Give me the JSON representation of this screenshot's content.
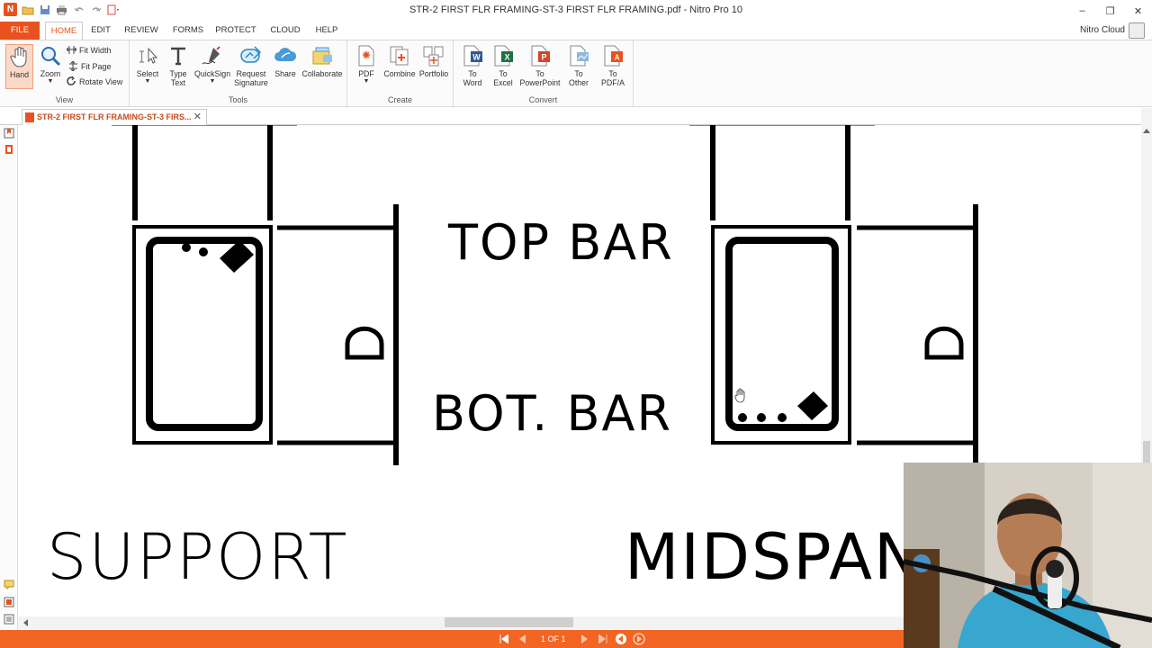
{
  "window": {
    "title": "STR-2 FIRST FLR FRAMING-ST-3 FIRST FLR FRAMING.pdf - Nitro Pro 10",
    "minimize": "–",
    "restore": "❐",
    "close": "✕"
  },
  "app_logo": "N",
  "tabs": [
    {
      "label": "FILE"
    },
    {
      "label": "HOME"
    },
    {
      "label": "EDIT"
    },
    {
      "label": "REVIEW"
    },
    {
      "label": "FORMS"
    },
    {
      "label": "PROTECT"
    },
    {
      "label": "CLOUD"
    },
    {
      "label": "HELP"
    }
  ],
  "account": {
    "label": "Nitro Cloud"
  },
  "ribbon": {
    "view": {
      "label": "View",
      "hand": "Hand",
      "zoom": "Zoom",
      "fit_width": "Fit Width",
      "fit_page": "Fit Page",
      "rotate_view": "Rotate View"
    },
    "tools": {
      "label": "Tools",
      "select": "Select",
      "type_text_1": "Type",
      "type_text_2": "Text",
      "quicksign": "QuickSign",
      "request_sig_1": "Request",
      "request_sig_2": "Signature",
      "share": "Share",
      "collaborate": "Collaborate"
    },
    "create": {
      "label": "Create",
      "pdf": "PDF",
      "combine": "Combine",
      "portfolio": "Portfolio"
    },
    "convert": {
      "label": "Convert",
      "to_word_1": "To",
      "to_word_2": "Word",
      "to_excel_1": "To",
      "to_excel_2": "Excel",
      "to_ppt_1": "To",
      "to_ppt_2": "PowerPoint",
      "to_other_1": "To",
      "to_other_2": "Other",
      "to_pdfa_1": "To",
      "to_pdfa_2": "PDF/A"
    }
  },
  "document_tab": {
    "label": "STR-2 FIRST FLR FRAMING-ST-3 FIRS...",
    "close": "✕"
  },
  "drawing": {
    "top_bar": "TOP BAR",
    "bot_bar": "BOT. BAR",
    "support": "SUPPORT",
    "midspan": "MIDSPAN"
  },
  "status": {
    "page_indicator": "1 OF 1"
  },
  "colors": {
    "accent": "#f26522",
    "accent_dark": "#e8521e",
    "ribbon_bg": "#fbfbfb"
  }
}
